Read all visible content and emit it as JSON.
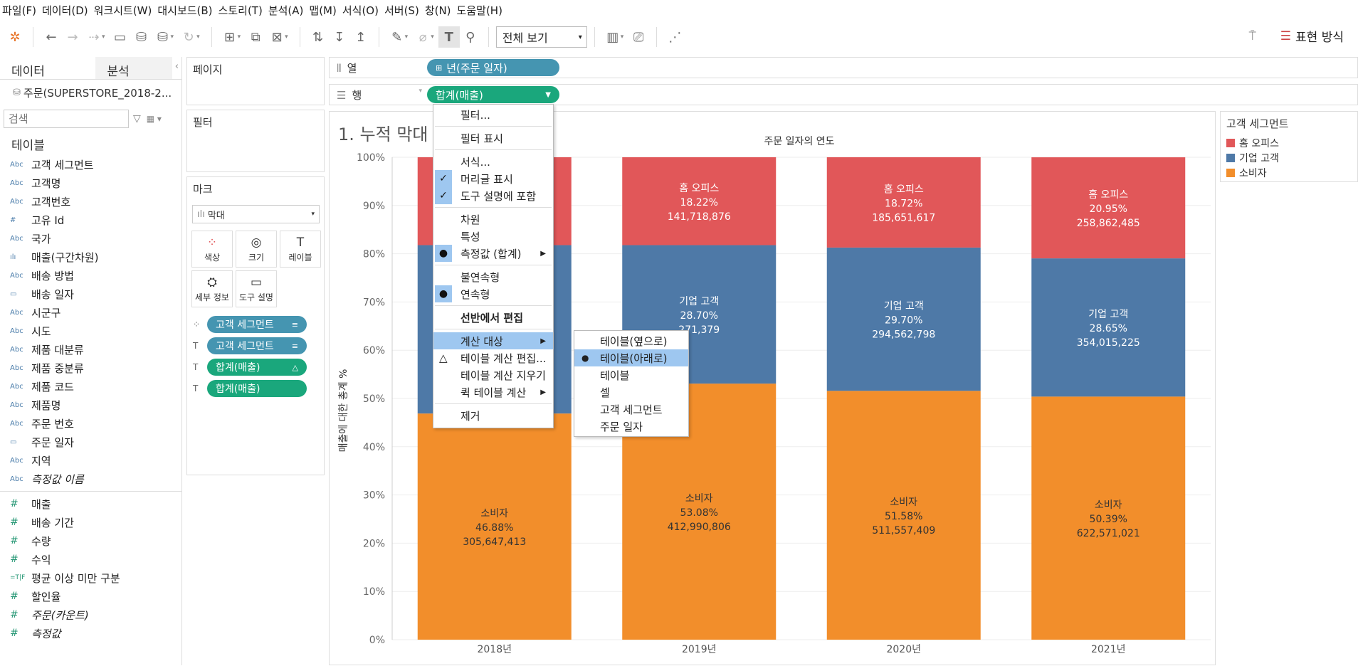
{
  "menubar": [
    "파일(F)",
    "데이터(D)",
    "워크시트(W)",
    "대시보드(B)",
    "스토리(T)",
    "분석(A)",
    "맵(M)",
    "서식(O)",
    "서버(S)",
    "창(N)",
    "도움말(H)"
  ],
  "toolbar": {
    "view_select": "전체 보기",
    "show_me": "표현 방식"
  },
  "data_pane": {
    "tab_data": "데이터",
    "tab_analysis": "분석",
    "datasource": "주문(SUPERSTORE_2018-2...",
    "search_placeholder": "검색",
    "tables_title": "테이블",
    "dimensions": [
      {
        "type": "Abc",
        "name": "고객 세그먼트"
      },
      {
        "type": "Abc",
        "name": "고객명"
      },
      {
        "type": "Abc",
        "name": "고객번호"
      },
      {
        "type": "#",
        "name": "고유 Id"
      },
      {
        "type": "Abc",
        "name": "국가"
      },
      {
        "type": "bin",
        "name": "매출(구간차원)"
      },
      {
        "type": "Abc",
        "name": "배송 방법"
      },
      {
        "type": "date",
        "name": "배송 일자"
      },
      {
        "type": "Abc",
        "name": "시군구"
      },
      {
        "type": "Abc",
        "name": "시도"
      },
      {
        "type": "Abc",
        "name": "제품 대분류"
      },
      {
        "type": "Abc",
        "name": "제품 중분류"
      },
      {
        "type": "Abc",
        "name": "제품 코드"
      },
      {
        "type": "Abc",
        "name": "제품명"
      },
      {
        "type": "Abc",
        "name": "주문 번호"
      },
      {
        "type": "date",
        "name": "주문 일자"
      },
      {
        "type": "Abc",
        "name": "지역"
      },
      {
        "type": "Abc",
        "name": "측정값 이름",
        "italic": true
      }
    ],
    "measures": [
      {
        "type": "#",
        "name": "매출"
      },
      {
        "type": "#",
        "name": "배송 기간"
      },
      {
        "type": "#",
        "name": "수량"
      },
      {
        "type": "#",
        "name": "수익"
      },
      {
        "type": "=T|F",
        "name": "평균 이상 미만 구분"
      },
      {
        "type": "#",
        "name": "할인율"
      },
      {
        "type": "#",
        "name": "주문(카운트)",
        "italic": true
      },
      {
        "type": "#",
        "name": "측정값",
        "italic": true
      }
    ]
  },
  "cards": {
    "pages": "페이지",
    "filters": "필터",
    "marks": "마크",
    "mark_type": "막대",
    "mark_buttons": [
      {
        "icon": "color-icon",
        "label": "색상"
      },
      {
        "icon": "size-icon",
        "label": "크기"
      },
      {
        "icon": "label-icon",
        "label": "레이블"
      },
      {
        "icon": "detail-icon",
        "label": "세부 정보"
      },
      {
        "icon": "tooltip-icon",
        "label": "도구 설명"
      }
    ],
    "mark_pills": [
      {
        "kind": "dim",
        "label": "고객 세그먼트",
        "badge": "≡"
      },
      {
        "kind": "dim",
        "label": "고객 세그먼트",
        "badge": "≡"
      },
      {
        "kind": "meas",
        "label": "합계(매출)",
        "badge": "△"
      },
      {
        "kind": "meas",
        "label": "합계(매출)",
        "badge": ""
      }
    ]
  },
  "shelves": {
    "columns_label": "열",
    "rows_label": "행",
    "columns_pill": "년(주문 일자)",
    "rows_pill": "합계(매출)"
  },
  "chart": {
    "title": "1. 누적 막대",
    "x_header": "주문 일자의 연도",
    "ylabel": "매출에 대한 총계 %"
  },
  "legend": {
    "title": "고객 세그먼트",
    "items": [
      {
        "name": "홈 오피스",
        "color": "#e15759"
      },
      {
        "name": "기업 고객",
        "color": "#4e79a7"
      },
      {
        "name": "소비자",
        "color": "#f28e2b"
      }
    ]
  },
  "context_menu": {
    "items": [
      {
        "label": "필터...",
        "sep_after": true
      },
      {
        "label": "필터 표시",
        "sep_after": true
      },
      {
        "label": "서식..."
      },
      {
        "label": "머리글 표시",
        "check": "✓"
      },
      {
        "label": "도구 설명에 포함",
        "check": "✓",
        "sep_after": true
      },
      {
        "label": "차원"
      },
      {
        "label": "특성"
      },
      {
        "label": "측정값 (합계)",
        "check": "●",
        "arrow": true,
        "sep_after": true
      },
      {
        "label": "불연속형"
      },
      {
        "label": "연속형",
        "check": "●",
        "sep_after": true
      },
      {
        "label": "선반에서 편집",
        "bold": true,
        "sep_after": true
      },
      {
        "label": "계산 대상",
        "arrow": true,
        "highlight": true
      },
      {
        "label": "테이블 계산 편집...",
        "prefix": "△"
      },
      {
        "label": "테이블 계산 지우기"
      },
      {
        "label": "퀵 테이블 계산",
        "arrow": true,
        "sep_after": true
      },
      {
        "label": "제거"
      }
    ],
    "submenu": [
      {
        "label": "테이블(옆으로)"
      },
      {
        "label": "테이블(아래로)",
        "selected": true
      },
      {
        "label": "테이블"
      },
      {
        "label": "셀"
      },
      {
        "label": "고객 세그먼트"
      },
      {
        "label": "주문 일자"
      }
    ]
  },
  "chart_data": {
    "type": "bar",
    "stacked": true,
    "title": "1. 누적 막대",
    "xlabel": "주문 일자의 연도",
    "ylabel": "매출에 대한 총계 %",
    "categories": [
      "2018년",
      "2019년",
      "2020년",
      "2021년"
    ],
    "y_ticks": [
      "0%",
      "10%",
      "20%",
      "30%",
      "40%",
      "50%",
      "60%",
      "70%",
      "80%",
      "90%",
      "100%"
    ],
    "ylim": [
      0,
      100
    ],
    "series": [
      {
        "name": "소비자",
        "color": "#f28e2b",
        "label_color": "#333333",
        "values": [
          46.88,
          53.08,
          51.58,
          50.39
        ],
        "pct_labels": [
          "46.88%",
          "53.08%",
          "51.58%",
          "50.39%"
        ],
        "amount_labels": [
          "305,647,413",
          "412,990,806",
          "511,557,409",
          "622,571,021"
        ]
      },
      {
        "name": "기업 고객",
        "color": "#4e79a7",
        "label_color": "#ffffff",
        "values": [
          34.9,
          28.7,
          29.7,
          28.65
        ],
        "pct_labels": [
          "",
          "28.70%",
          "29.70%",
          "28.65%"
        ],
        "amount_labels": [
          "",
          "271,379",
          "294,562,798",
          "354,015,225"
        ]
      },
      {
        "name": "홈 오피스",
        "color": "#e15759",
        "label_color": "#ffffff",
        "values": [
          18.22,
          18.22,
          18.72,
          20.95
        ],
        "pct_labels": [
          "",
          "18.22%",
          "18.72%",
          "20.95%"
        ],
        "amount_labels": [
          "",
          "141,718,876",
          "185,651,617",
          "258,862,485"
        ]
      }
    ]
  }
}
